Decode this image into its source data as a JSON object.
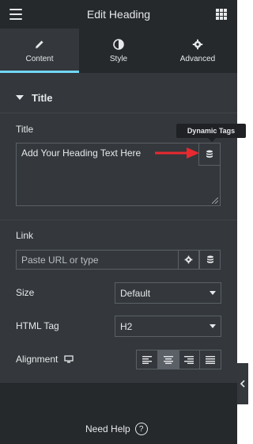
{
  "topbar": {
    "title": "Edit Heading",
    "menu_icon": "hamburger-icon",
    "apps_icon": "grid-icon"
  },
  "tabs": [
    {
      "label": "Content",
      "icon": "pencil-icon",
      "active": true
    },
    {
      "label": "Style",
      "icon": "half-circle-icon",
      "active": false
    },
    {
      "label": "Advanced",
      "icon": "gear-icon",
      "active": false
    }
  ],
  "section": {
    "title": "Title"
  },
  "title_field": {
    "label": "Title",
    "value": "Add Your Heading Text Here",
    "dynamic_tags_tooltip": "Dynamic Tags"
  },
  "link_field": {
    "label": "Link",
    "placeholder": "Paste URL or type"
  },
  "size_field": {
    "label": "Size",
    "value": "Default"
  },
  "html_tag_field": {
    "label": "HTML Tag",
    "value": "H2"
  },
  "alignment_field": {
    "label": "Alignment",
    "options": [
      "left",
      "center",
      "right",
      "justify"
    ],
    "selected": "center"
  },
  "footer": {
    "need_help": "Need Help"
  },
  "colors": {
    "accent": "#71d7f7",
    "panel": "#34383c",
    "header": "#26292c",
    "arrow": "#e8292f"
  }
}
